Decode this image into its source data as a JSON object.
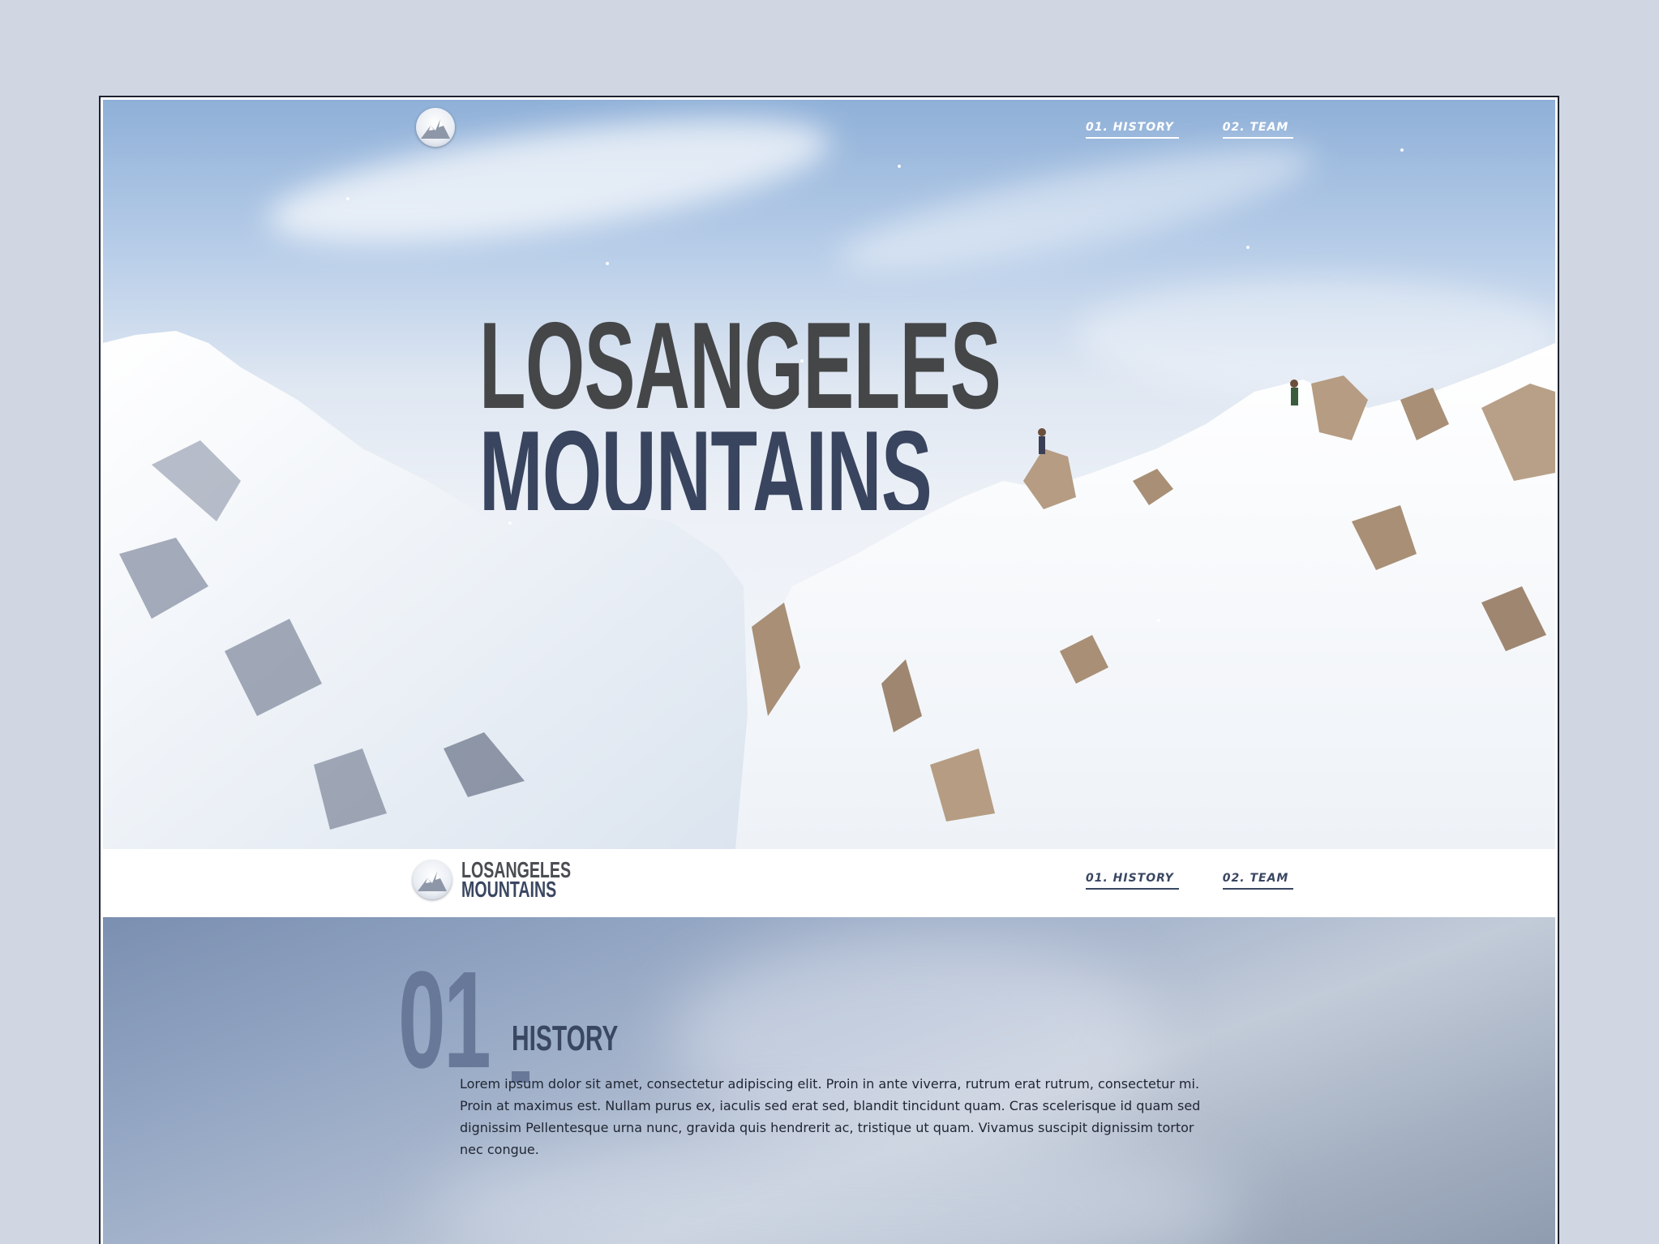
{
  "brand": {
    "line1": "LOSANGELES",
    "line2": "MOUNTAINS",
    "logo_icon": "mountain-logo-icon"
  },
  "nav": {
    "history": "01. HISTORY",
    "team": "02. TEAM"
  },
  "hero": {
    "title_line1": "LOSANGELES",
    "title_line2": "MOUNTAINS"
  },
  "section": {
    "number": "01",
    "title": "HISTORY",
    "body": "Lorem ipsum dolor sit amet, consectetur adipiscing elit. Proin in ante viverra, rutrum erat rutrum, consectetur mi. Proin at maximus est. Nullam purus ex, iaculis sed erat sed, blandit tincidunt quam. Cras scelerisque id quam sed dignissim Pellentesque urna nunc, gravida quis hendrerit ac, tristique ut quam. Vivamus suscipit dignissim tortor nec congue."
  },
  "colors": {
    "page_bg": "#d1d7e2",
    "navy": "#3a4762",
    "dark_gray": "#454648",
    "section_number": "#687899"
  }
}
